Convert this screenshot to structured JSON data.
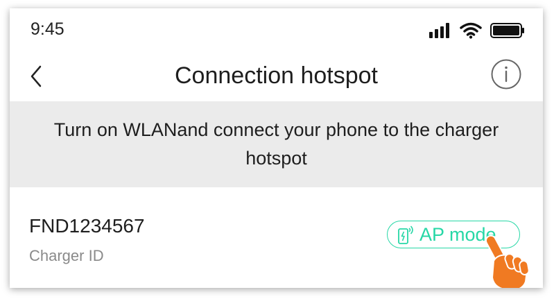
{
  "statusbar": {
    "time": "9:45",
    "icons": [
      "cellular-signal-icon",
      "wifi-icon",
      "battery-icon"
    ]
  },
  "navbar": {
    "title": "Connection hotspot",
    "back_icon": "back-chevron-icon",
    "info_icon": "info-icon"
  },
  "banner": {
    "text": "Turn on WLANand connect your phone to the charger hotspot"
  },
  "charger": {
    "id": "FND1234567",
    "label": "Charger ID"
  },
  "ap_button": {
    "label": "AP mode",
    "icon": "phone-hotspot-icon"
  },
  "pointer": {
    "icon": "tap-hand-icon"
  },
  "colors": {
    "accent": "#26d7a6",
    "banner_bg": "#ebebeb",
    "hand": "#f07a22"
  }
}
